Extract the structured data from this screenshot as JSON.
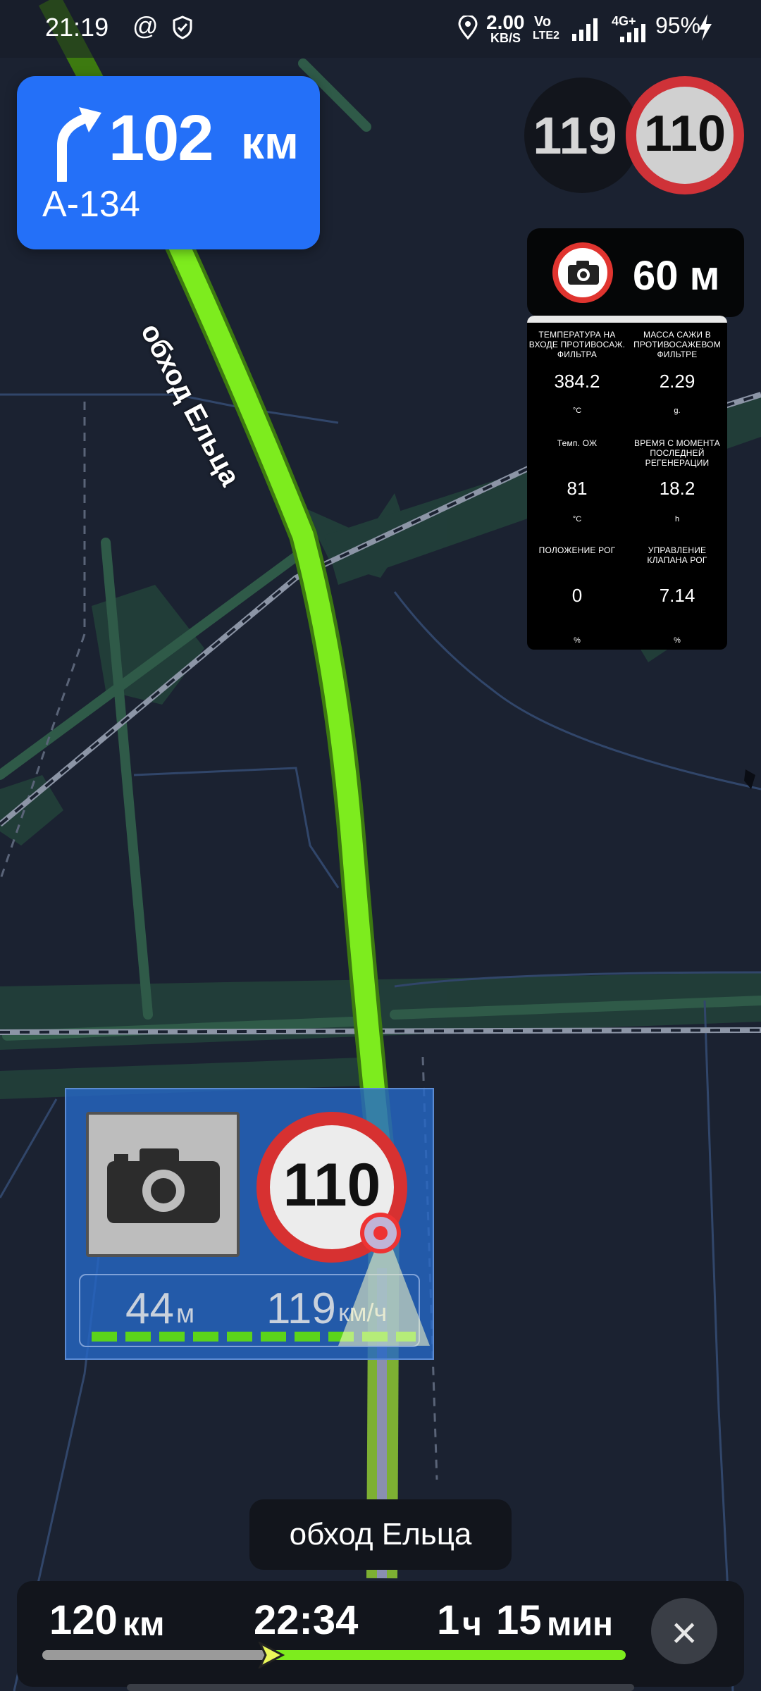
{
  "status_bar": {
    "time": "21:19",
    "at_icon": "at-sign-icon",
    "shield_icon": "shield-check-icon",
    "location_icon": "location-pin-icon",
    "net_speed_value": "2.00",
    "net_speed_unit": "KB/S",
    "volte_top": "Vo",
    "volte_bottom": "LTE2",
    "network_type": "4G+",
    "battery": "95%"
  },
  "maneuver": {
    "icon": "turn-right-arrow-icon",
    "distance_value": "102",
    "distance_unit": "км",
    "road": "А-134"
  },
  "speed": {
    "current": "119",
    "limit": "110"
  },
  "camera_alert": {
    "icon": "camera-icon",
    "distance": "60 м"
  },
  "obd_panel": {
    "cells": [
      {
        "label": "ТЕМПЕРАТУРА НА ВХОДЕ ПРОТИВОСАЖ. ФИЛЬТРА",
        "value": "384.2",
        "unit": "°C"
      },
      {
        "label": "МАССА САЖИ В ПРОТИВОСАЖЕВОМ ФИЛЬТРЕ",
        "value": "2.29",
        "unit": "g."
      },
      {
        "label": "Темп. ОЖ",
        "value": "81",
        "unit": "°C"
      },
      {
        "label": "ВРЕМЯ С МОМЕНТА ПОСЛЕДНЕЙ РЕГЕНЕРАЦИИ",
        "value": "18.2",
        "unit": "h"
      },
      {
        "label": "ПОЛОЖЕНИЕ РОГ",
        "value": "0",
        "unit": "%"
      },
      {
        "label": "УПРАВЛЕНИЕ КЛАПАНА РОГ",
        "value": "7.14",
        "unit": "%"
      }
    ]
  },
  "camera_widget": {
    "limit": "110",
    "distance_value": "44",
    "distance_unit": "м",
    "speed_value": "119",
    "speed_unit": "км/ч"
  },
  "map": {
    "road_label": "обход Ельца"
  },
  "street_label": "обход Ельца",
  "trip": {
    "remaining_value": "120",
    "remaining_unit": "км",
    "arrival_time": "22:34",
    "eta_hours": "1",
    "eta_hours_unit": "ч",
    "eta_minutes": "15",
    "eta_minutes_unit": "мин",
    "progress_fraction": 0.39,
    "close_icon": "close-icon"
  },
  "colors": {
    "route": "#7dec1e",
    "maneuver_bg": "#2470f8",
    "speed_limit_ring": "#cf3238",
    "map_bg": "#1b2231"
  }
}
